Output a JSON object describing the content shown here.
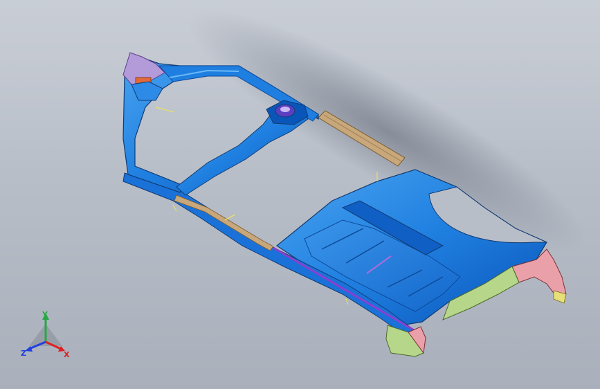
{
  "viewport": {
    "background_top": "#c9ced6",
    "background_bottom": "#a9b0bb"
  },
  "model": {
    "name": "car-body-floor-frame-assembly",
    "colors": {
      "primary_blue": "#1f7fe0",
      "dark_blue": "#0a55b8",
      "light_blue": "#4aa4f0",
      "tan_rail": "#c8a87a",
      "purple_sill": "#8a3fd0",
      "pink_bracket": "#e9a0a8",
      "green_part": "#b6d68a",
      "yellow_part": "#e7e07a",
      "dark_edge": "#123b73"
    }
  },
  "triad": {
    "y_label": "Y",
    "x_label": "X",
    "z_label": "Z",
    "y_color": "#27a844",
    "x_color": "#e02020",
    "z_color": "#2040e0"
  }
}
